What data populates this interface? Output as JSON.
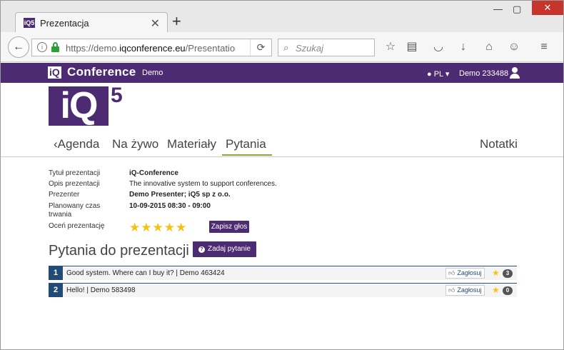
{
  "browser": {
    "tab_title": "Prezentacja",
    "tab_favicon": "iQ5",
    "url_prefix": "https://demo.",
    "url_domain": "iqconference.eu",
    "url_path": "/Presentation",
    "search_placeholder": "Szukaj",
    "icons": [
      "star-icon",
      "reading-list-icon",
      "pocket-icon",
      "download-icon",
      "home-icon",
      "smiley-icon",
      "hamburger-menu-icon"
    ]
  },
  "site_header": {
    "brand_iq": "iQ",
    "brand_name": "Conference",
    "brand_demo": "Demo",
    "language": "PL",
    "user": "Demo 233488"
  },
  "logo": {
    "text": "iQ",
    "sup": "5"
  },
  "tabs": {
    "agenda": "Agenda",
    "live": "Na żywo",
    "materials": "Materiały",
    "questions": "Pytania",
    "notes": "Notatki"
  },
  "presentation": {
    "title_label": "Tytuł prezentacji",
    "title_value": "iQ-Conference",
    "desc_label": "Opis prezentacji",
    "desc_value": "The innovative system to support conferences.",
    "presenter_label": "Prezenter",
    "presenter_value": "Demo Presenter; iQ5 sp z o.o.",
    "time_label_1": "Planowany czas",
    "time_label_2": "trwania",
    "time_value": "10-09-2015  08:30 - 09:00",
    "rate_label": "Oceń prezentację",
    "rating": 5,
    "save_vote": "Zapisz głos"
  },
  "questions_section": {
    "title": "Pytania do prezentacji",
    "ask_button": "Zadaj pytanie",
    "items": [
      {
        "num": "1",
        "text": "Good system. Where can I buy it? | Demo 463424",
        "vote_label": "Zagłosuj",
        "count": "3"
      },
      {
        "num": "2",
        "text": "Hello! | Demo 583498",
        "vote_label": "Zagłosuj",
        "count": "0"
      }
    ]
  },
  "colors": {
    "brand": "#4c2b73",
    "question_num": "#214b75",
    "star": "#f2c314",
    "active_tab": "#8aa33a"
  }
}
